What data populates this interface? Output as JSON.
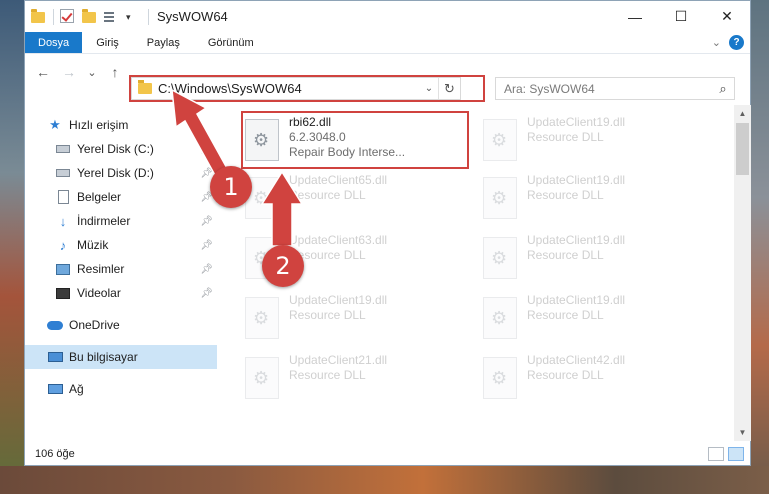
{
  "window": {
    "title": "SysWOW64",
    "minimize": "—",
    "maximize": "☐",
    "close": "✕"
  },
  "ribbon": {
    "tabs": [
      {
        "label": "Dosya",
        "active": true
      },
      {
        "label": "Giriş"
      },
      {
        "label": "Paylaş"
      },
      {
        "label": "Görünüm"
      }
    ],
    "help": "?"
  },
  "nav": {
    "back": "←",
    "forward": "→",
    "recent": "⌄",
    "up": "↑",
    "address": "C:\\Windows\\SysWOW64",
    "search_placeholder": "Ara: SysWOW64"
  },
  "sidebar": {
    "items": [
      {
        "label": "Hızlı erişim",
        "icon": "star-icon"
      },
      {
        "label": "Yerel Disk (C:)",
        "icon": "drive-icon",
        "pinned": true
      },
      {
        "label": "Yerel Disk (D:)",
        "icon": "drive-icon",
        "pinned": true
      },
      {
        "label": "Belgeler",
        "icon": "document-icon",
        "pinned": true
      },
      {
        "label": "İndirmeler",
        "icon": "download-icon",
        "pinned": true
      },
      {
        "label": "Müzik",
        "icon": "music-icon",
        "pinned": true
      },
      {
        "label": "Resimler",
        "icon": "pictures-icon",
        "pinned": true
      },
      {
        "label": "Videolar",
        "icon": "video-icon",
        "pinned": true
      },
      {
        "label": "OneDrive",
        "icon": "cloud-icon"
      },
      {
        "label": "Bu bilgisayar",
        "icon": "computer-icon",
        "selected": true
      },
      {
        "label": "Ağ",
        "icon": "network-icon"
      }
    ]
  },
  "files": {
    "highlighted": {
      "name": "rbi62.dll",
      "version": "6.2.3048.0",
      "description": "Repair Body Interse..."
    },
    "left_column": [
      {
        "name": "UpdateClient65.dll",
        "desc": "Resource DLL"
      },
      {
        "name": "UpdateClient63.dll",
        "desc": "Resource DLL"
      },
      {
        "name": "UpdateClient19.dll",
        "desc": "Resource DLL"
      },
      {
        "name": "UpdateClient21.dll",
        "desc": "Resource DLL"
      }
    ],
    "right_column": [
      {
        "name": "UpdateClient19.dll",
        "desc": "Resource DLL"
      },
      {
        "name": "UpdateClient19.dll",
        "desc": "Resource DLL"
      },
      {
        "name": "UpdateClient19.dll",
        "desc": "Resource DLL"
      },
      {
        "name": "UpdateClient19.dll",
        "desc": "Resource DLL"
      },
      {
        "name": "UpdateClient42.dll",
        "desc": "Resource DLL"
      }
    ]
  },
  "status": {
    "count": "106 öğe"
  },
  "annotations": {
    "badge1": "1",
    "badge2": "2",
    "color": "#d0433f"
  }
}
